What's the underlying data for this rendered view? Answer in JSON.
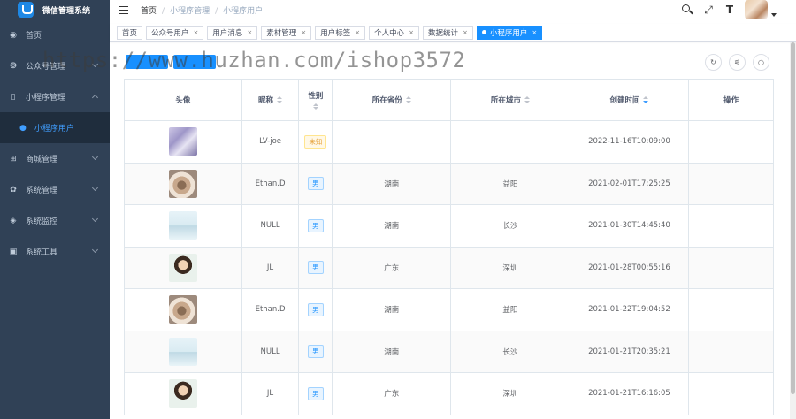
{
  "app": {
    "title": "微信管理系统"
  },
  "sidebar": {
    "items": [
      {
        "label": "首页",
        "icon": "dashboard-icon",
        "glyph": "◉"
      },
      {
        "label": "公众号管理",
        "icon": "wechat-icon",
        "glyph": "❂"
      },
      {
        "label": "小程序管理",
        "icon": "mobile-icon",
        "glyph": "▯"
      },
      {
        "label": "商城管理",
        "icon": "cart-icon",
        "glyph": "⊞"
      },
      {
        "label": "系统管理",
        "icon": "gear-icon",
        "glyph": "✿"
      },
      {
        "label": "系统监控",
        "icon": "monitor-icon",
        "glyph": "◈"
      },
      {
        "label": "系统工具",
        "icon": "toolbox-icon",
        "glyph": "▣"
      }
    ],
    "submenu": {
      "label": "小程序用户",
      "icon": "user-icon",
      "glyph": "●"
    }
  },
  "navbar": {
    "breadcrumb": [
      "首页",
      "小程序管理",
      "小程序用户"
    ],
    "font_size_glyph": "T",
    "fullscreen_glyph": "⤢"
  },
  "tags": [
    {
      "label": "首页"
    },
    {
      "label": "公众号用户"
    },
    {
      "label": "用户消息"
    },
    {
      "label": "素材管理"
    },
    {
      "label": "用户标签"
    },
    {
      "label": "个人中心"
    },
    {
      "label": "数据统计"
    },
    {
      "label": "小程序用户",
      "active": true
    }
  ],
  "tag_close": "×",
  "toolbar": {
    "refresh_glyph": "↻",
    "columns_glyph": "⚟",
    "search_glyph": "○"
  },
  "watermark": "https://www.huzhan.com/ishop3572",
  "table": {
    "headers": [
      "头像",
      "昵称",
      "性别",
      "所在省份",
      "所在城市",
      "创建时间",
      "操作"
    ],
    "rows": [
      {
        "avatar": "lv",
        "nickname": "LV-joe",
        "gender": "未知",
        "province": "",
        "city": "",
        "created": "2022-11-16T10:09:00"
      },
      {
        "avatar": "cat",
        "nickname": "Ethan.D",
        "gender": "男",
        "province": "湖南",
        "city": "益阳",
        "created": "2021-02-01T17:25:25"
      },
      {
        "avatar": "null",
        "nickname": "NULL",
        "gender": "男",
        "province": "湖南",
        "city": "长沙",
        "created": "2021-01-30T14:45:40"
      },
      {
        "avatar": "jl",
        "nickname": "JL",
        "gender": "男",
        "province": "广东",
        "city": "深圳",
        "created": "2021-01-28T00:55:16"
      },
      {
        "avatar": "cat",
        "nickname": "Ethan.D",
        "gender": "男",
        "province": "湖南",
        "city": "益阳",
        "created": "2021-01-22T19:04:52"
      },
      {
        "avatar": "null",
        "nickname": "NULL",
        "gender": "男",
        "province": "湖南",
        "city": "长沙",
        "created": "2021-01-21T20:35:21"
      },
      {
        "avatar": "jl",
        "nickname": "JL",
        "gender": "男",
        "province": "广东",
        "city": "深圳",
        "created": "2021-01-21T16:16:05"
      }
    ]
  },
  "colors": {
    "sidebar_bg": "#304156",
    "accent": "#1890ff",
    "submenu_bg": "#1f2d3d"
  }
}
